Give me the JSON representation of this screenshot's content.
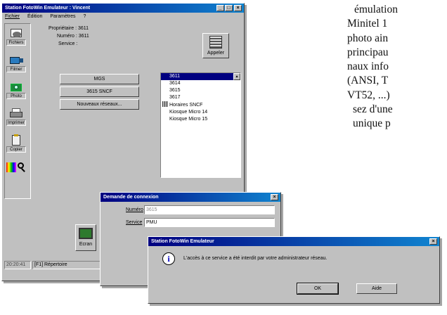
{
  "main_window": {
    "title": "Station FotoWin Emulateur : Vincent",
    "menu": [
      "Fichier",
      "Édition",
      "Paramètres",
      "?"
    ],
    "toolbar": [
      "Fichiers",
      "Filmer",
      "Photo",
      "Imprimer",
      "Copier"
    ],
    "info": {
      "proprietaire": "Propriétaire : 3611",
      "numero": "Numéro : 3611",
      "service": "Service :"
    },
    "appeler": "Appeler",
    "buttons": [
      "MGS",
      "3615 SNCF",
      "Nouveaux réseaux..."
    ],
    "service_list": [
      "3611",
      "3614",
      "3615",
      "3617",
      "Horaires SNCF",
      "Kiosque Micro 14",
      "Kiosque Micro 15"
    ],
    "bottom_button": "Ecran",
    "status": [
      "20:20:41",
      "[F1] Répertoire"
    ]
  },
  "connection_dialog": {
    "title": "Demande de connexion",
    "numero_label": "Numéro",
    "numero_value": "3615",
    "service_label": "Service",
    "service_value": "PMU"
  },
  "alert_dialog": {
    "title": "Station FotoWin Emulateur",
    "message": "L'accès à ce service a été interdit par votre administrateur réseau.",
    "ok": "OK",
    "aide": "Aide"
  },
  "article_text": [
    "émulation",
    "Minitel 1",
    "photo ain",
    "principau",
    "naux info",
    "(ANSI, T",
    "VT52, ...)",
    " sez d'une",
    " unique p"
  ]
}
